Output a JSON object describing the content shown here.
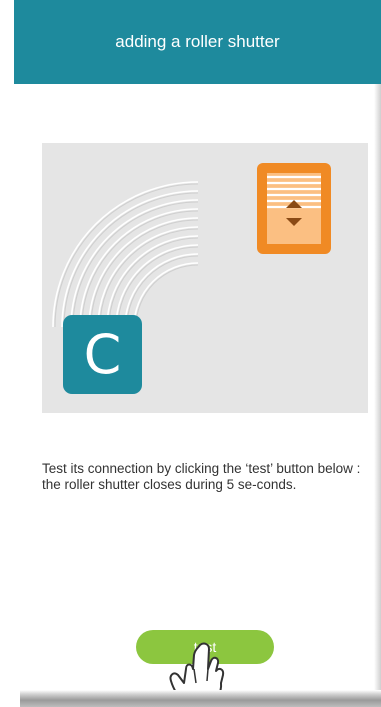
{
  "header": {
    "title": "adding a roller shutter"
  },
  "illustration": {
    "hub_letter": "C"
  },
  "instructions": "Test its connection by clicking the ‘test’ button below : the roller shutter closes during 5 se-conds.",
  "test_button": {
    "label": "test"
  },
  "icons": [
    "hub-c-icon",
    "roller-shutter-icon",
    "signal-waves-icon",
    "hand-pointer-icon"
  ],
  "colors": {
    "header": "#1e8a9d",
    "hub": "#1e8a9d",
    "shutter": "#f08a24",
    "button": "#8cc63f",
    "illustration_bg": "#e5e5e5"
  }
}
